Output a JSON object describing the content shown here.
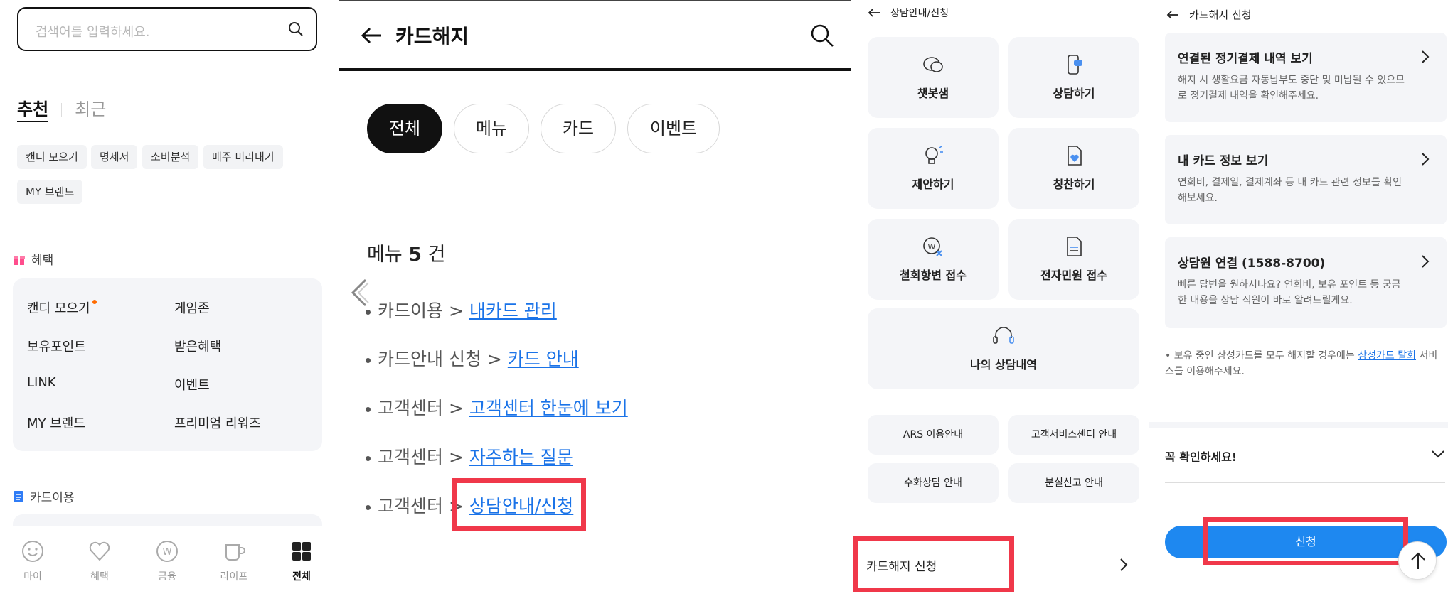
{
  "panel1": {
    "search_placeholder": "검색어를 입력하세요.",
    "tabs": {
      "recommended": "추천",
      "recent": "최근"
    },
    "chips": [
      "캔디 모으기",
      "명세서",
      "소비분석",
      "매주 미리내기",
      "MY 브랜드"
    ],
    "benefits_title": "혜택",
    "benefits": [
      "캔디 모으기",
      "게임존",
      "보유포인트",
      "받은혜택",
      "LINK",
      "이벤트",
      "MY 브랜드",
      "프리미엄 리워즈"
    ],
    "card_use_title": "카드이용",
    "nav": [
      "마이",
      "혜택",
      "금융",
      "라이프",
      "전체"
    ]
  },
  "panel2": {
    "title": "카드해지",
    "filters": [
      "전체",
      "메뉴",
      "카드",
      "이벤트"
    ],
    "count_prefix": "메뉴",
    "count_value": "5",
    "count_suffix": "건",
    "results": [
      {
        "path": "카드이용 > ",
        "link": "내카드 관리"
      },
      {
        "path": "카드안내 신청 > ",
        "link": "카드 안내"
      },
      {
        "path": "고객센터 > ",
        "link": "고객센터 한눈에 보기"
      },
      {
        "path": "고객센터 > ",
        "link": "자주하는 질문"
      },
      {
        "path": "고객센터 > ",
        "link": "상담안내/신청"
      }
    ]
  },
  "panel3": {
    "header": "상담안내/신청",
    "tiles": [
      "챗봇샘",
      "상담하기",
      "제안하기",
      "칭찬하기",
      "철회항변 접수",
      "전자민원 접수"
    ],
    "wide_tile": "나의 상담내역",
    "small_tiles": [
      "ARS 이용안내",
      "고객서비스센터 안내",
      "수화상담 안내",
      "분실신고 안내"
    ],
    "row_label": "카드해지 신청"
  },
  "panel4": {
    "header": "카드해지 신청",
    "cards": [
      {
        "title": "연결된 정기결제 내역 보기",
        "desc": "해지 시 생활요금 자동납부도 중단 및 미납될 수 있으므로 정기결제 내역을 확인해주세요."
      },
      {
        "title": "내 카드 정보 보기",
        "desc": "연회비, 결제일, 결제계좌 등 내 카드 관련 정보를 확인해보세요."
      },
      {
        "title": "상담원 연결 (1588-8700)",
        "desc": "빠른 답변을 원하시나요? 연회비, 보유 포인트 등 궁금한 내용을 상담 직원이 바로 알려드릴게요."
      }
    ],
    "note_prefix": "• 보유 중인 삼성카드를 모두 해지할 경우에는 ",
    "note_link": "삼성카드 탈회",
    "note_suffix": " 서비스를 이용해주세요.",
    "check_label": "꼭 확인하세요!",
    "apply_label": "신청"
  },
  "colors": {
    "accent_blue": "#1e88f0",
    "link_blue": "#1a73e8",
    "highlight_red": "#f0384a",
    "tile_bg": "#f4f5f8"
  }
}
